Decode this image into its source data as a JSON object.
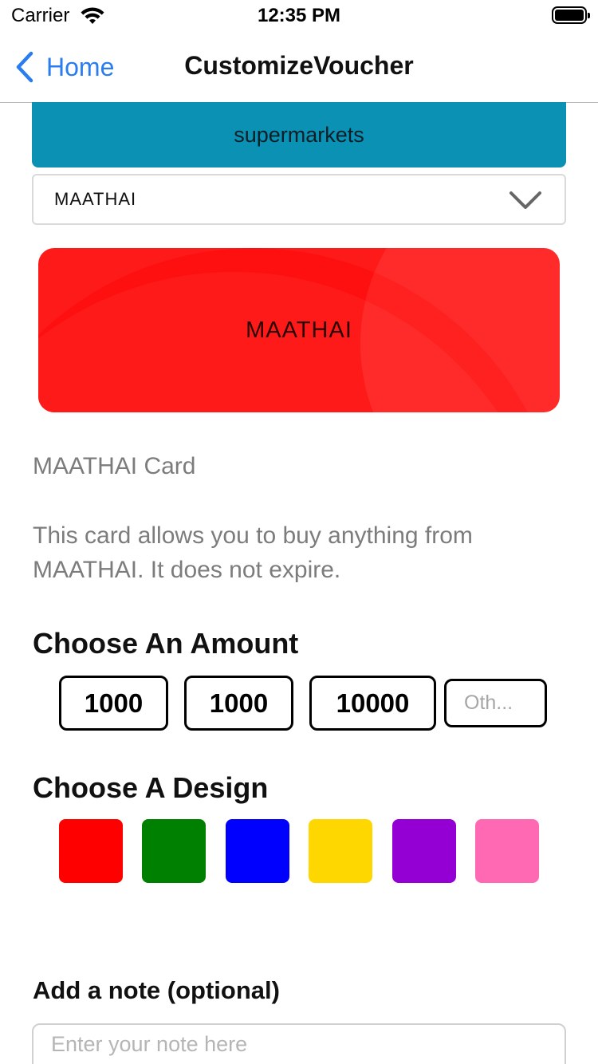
{
  "status_bar": {
    "carrier": "Carrier",
    "time": "12:35 PM"
  },
  "nav": {
    "back_label": "Home",
    "title": "CustomizeVoucher"
  },
  "category": {
    "label": "supermarkets",
    "color": "#0a91b4"
  },
  "store_select": {
    "selected": "MAATHAI"
  },
  "card": {
    "label": "MAATHAI",
    "color": "#ff1a1a"
  },
  "description": {
    "name": "MAATHAI Card",
    "text": "This card allows you to buy anything from MAATHAI. It does not expire."
  },
  "amount": {
    "heading": "Choose An Amount",
    "options": [
      "1000",
      "1000",
      "10000"
    ],
    "other_placeholder": "Oth..."
  },
  "design": {
    "heading": "Choose A Design",
    "colors": [
      "#ff0000",
      "#008000",
      "#0000ff",
      "#ffd700",
      "#9400d3",
      "#ff69b4"
    ]
  },
  "note": {
    "label": "Add a note (optional)",
    "placeholder": "Enter your note here"
  }
}
